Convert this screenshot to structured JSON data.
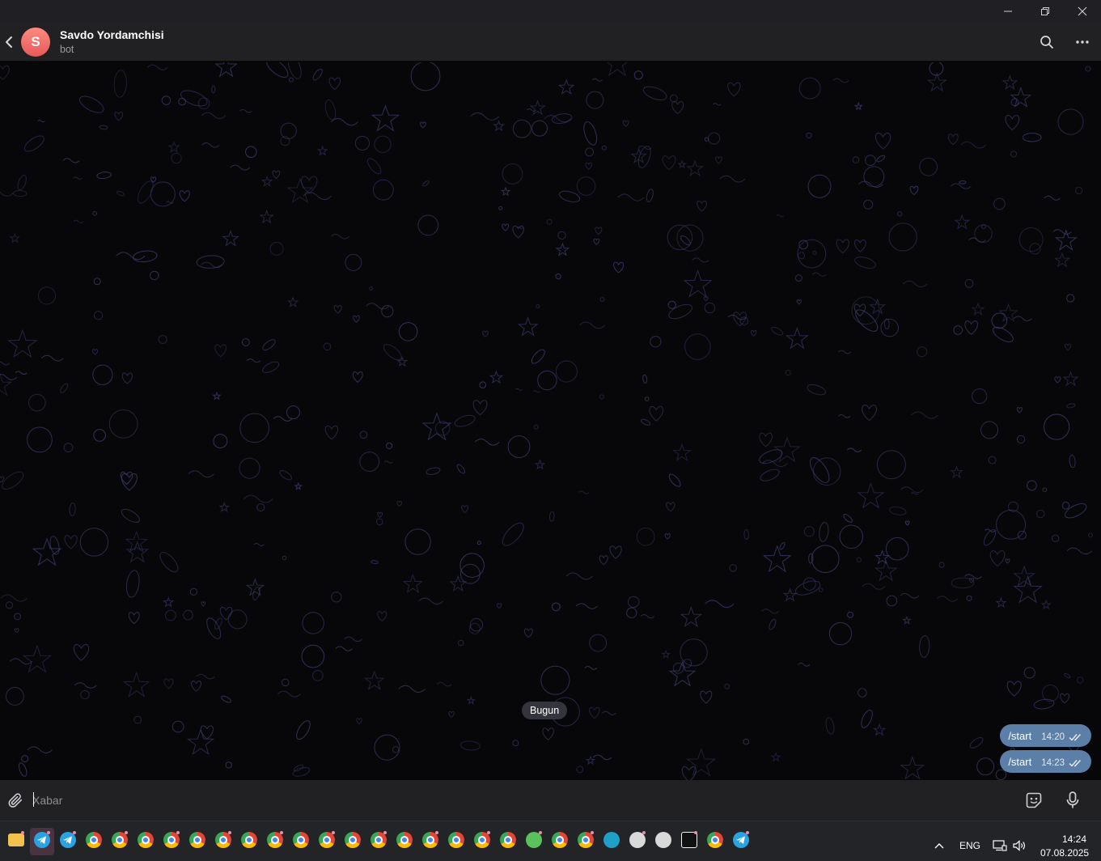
{
  "window": {
    "controls": {
      "minimize_icon": "minimize-icon",
      "maximize_icon": "restore-icon",
      "close_icon": "close-icon"
    }
  },
  "header": {
    "avatar_letter": "S",
    "title": "Savdo Yordamchisi",
    "subtitle": "bot",
    "icons": [
      "back-arrow-icon",
      "search-icon",
      "more-vertical-icon"
    ],
    "avatar_color": "#e9615f"
  },
  "chat": {
    "date_separator": "Bugun",
    "messages": [
      {
        "text": "/start",
        "time": "14:20",
        "status": "read"
      },
      {
        "text": "/start",
        "time": "14:23",
        "status": "read"
      }
    ],
    "bubble_color": "#5c7fa8",
    "background_color": "#070709",
    "pattern_color": "#3a3a6a"
  },
  "composer": {
    "placeholder": "Xabar",
    "value": "",
    "icons": [
      "paperclip-icon",
      "sticker-icon",
      "microphone-icon"
    ]
  },
  "taskbar": {
    "apps": [
      {
        "name": "file-explorer-icon",
        "color": "#f2c14e"
      },
      {
        "name": "telegram-icon",
        "color": "#2aa3e0",
        "active": true
      },
      {
        "name": "telegram-icon",
        "color": "#2aa3e0"
      },
      {
        "name": "chrome-icon",
        "color": "#4285f4"
      },
      {
        "name": "chrome-icon",
        "color": "#4285f4"
      },
      {
        "name": "chrome-icon",
        "color": "#4285f4"
      },
      {
        "name": "chrome-icon",
        "color": "#4285f4"
      },
      {
        "name": "chrome-icon",
        "color": "#4285f4"
      },
      {
        "name": "chrome-icon",
        "color": "#4285f4"
      },
      {
        "name": "chrome-icon",
        "color": "#4285f4"
      },
      {
        "name": "chrome-icon",
        "color": "#4285f4"
      },
      {
        "name": "chrome-icon",
        "color": "#4285f4"
      },
      {
        "name": "chrome-icon",
        "color": "#4285f4"
      },
      {
        "name": "chrome-icon",
        "color": "#4285f4"
      },
      {
        "name": "chrome-icon",
        "color": "#4285f4"
      },
      {
        "name": "chrome-icon",
        "color": "#4285f4"
      },
      {
        "name": "chrome-icon",
        "color": "#4285f4"
      },
      {
        "name": "chrome-icon",
        "color": "#4285f4"
      },
      {
        "name": "chrome-icon",
        "color": "#4285f4"
      },
      {
        "name": "chrome-icon",
        "color": "#4285f4"
      },
      {
        "name": "game-controller-icon",
        "color": "#59c25a"
      },
      {
        "name": "chrome-icon",
        "color": "#4285f4"
      },
      {
        "name": "chrome-icon",
        "color": "#4285f4"
      },
      {
        "name": "edge-icon",
        "color": "#1fa0c8"
      },
      {
        "name": "chatgpt-icon",
        "color": "#d9d9d9"
      },
      {
        "name": "github-icon",
        "color": "#d9d9d9"
      },
      {
        "name": "capcut-icon",
        "color": "#f0f0f0"
      },
      {
        "name": "chrome-icon",
        "color": "#4285f4"
      },
      {
        "name": "telegram-desktop-icon",
        "color": "#2aa3e0"
      }
    ],
    "tray": {
      "chevron_icon": "chevron-up-icon",
      "language": "ENG",
      "icons": [
        "network-icon",
        "volume-icon"
      ],
      "time": "14:24",
      "date": "07.08.2025"
    }
  }
}
